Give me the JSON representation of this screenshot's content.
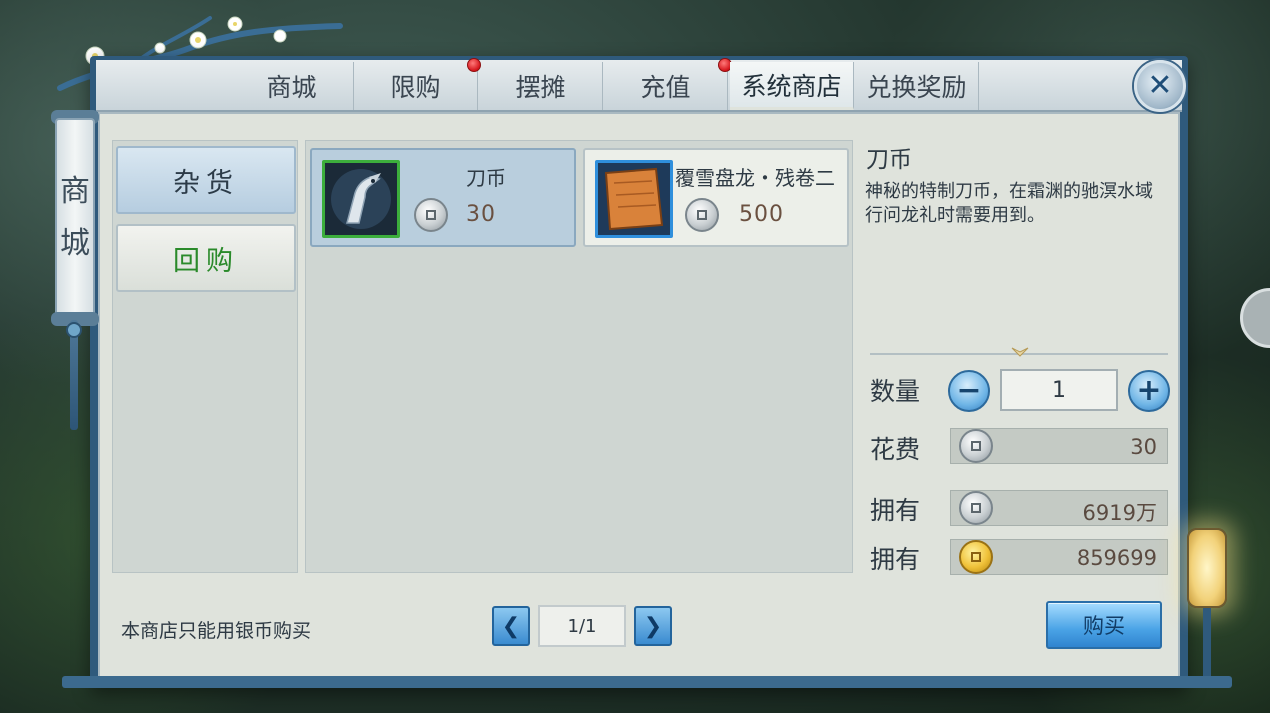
{
  "shop_title": "商城",
  "shop_title_chars": [
    "商",
    "城"
  ],
  "tabs": [
    {
      "label": "商城",
      "active": false,
      "has_badge": false
    },
    {
      "label": "限购",
      "active": false,
      "has_badge": true
    },
    {
      "label": "摆摊",
      "active": false,
      "has_badge": false
    },
    {
      "label": "充值",
      "active": false,
      "has_badge": true
    },
    {
      "label": "系统商店",
      "active": true,
      "has_badge": false
    },
    {
      "label": "兑换奖励",
      "active": false,
      "has_badge": false
    }
  ],
  "categories": [
    {
      "label": "杂货",
      "active": true
    },
    {
      "label": "回购",
      "active": false
    }
  ],
  "items": [
    {
      "name": "刀币",
      "price": "30",
      "currency": "silver-coin-icon",
      "selected": true
    },
    {
      "name": "覆雪盘龙・残卷二",
      "price": "500",
      "currency": "silver-coin-icon",
      "selected": false
    }
  ],
  "detail": {
    "title": "刀币",
    "description": "神秘的特制刀币，在霜渊的驰溟水域行问龙礼时需要用到。",
    "quantity_label": "数量",
    "quantity": "1",
    "cost_label": "花费",
    "cost": "30",
    "owned_label_1": "拥有",
    "owned_silver": "6919万",
    "owned_label_2": "拥有",
    "owned_gold": "859699"
  },
  "footer": {
    "note": "本商店只能用银币购买",
    "page": "1/1",
    "buy_label": "购买"
  },
  "colors": {
    "frame": "#2f5a7c",
    "panel": "#dfe3dc",
    "selected_card": "#b9cedd",
    "badge_red": "#d4141b",
    "buy_blue": "#4aa3e6",
    "green_text": "#2a8a2a"
  }
}
